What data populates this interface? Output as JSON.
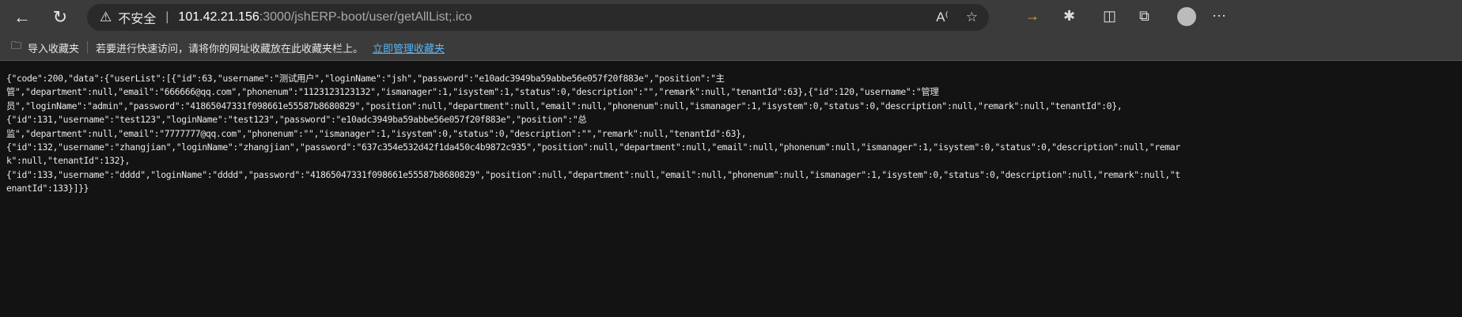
{
  "browser": {
    "security_label": "不安全",
    "url_host": "101.42.21.156",
    "url_path": ":3000/jshERP-boot/user/getAllList;.ico"
  },
  "bookmarks": {
    "import_label": "导入收藏夹",
    "hint": "若要进行快速访问，请将你的网址收藏放在此收藏夹栏上。",
    "manage_link": "立即管理收藏夹"
  },
  "response_lines": [
    "{\"code\":200,\"data\":{\"userList\":[{\"id\":63,\"username\":\"测试用户\",\"loginName\":\"jsh\",\"password\":\"e10adc3949ba59abbe56e057f20f883e\",\"position\":\"主",
    "管\",\"department\":null,\"email\":\"666666@qq.com\",\"phonenum\":\"1123123123132\",\"ismanager\":1,\"isystem\":1,\"status\":0,\"description\":\"\",\"remark\":null,\"tenantId\":63},{\"id\":120,\"username\":\"管理",
    "员\",\"loginName\":\"admin\",\"password\":\"41865047331f098661e55587b8680829\",\"position\":null,\"department\":null,\"email\":null,\"phonenum\":null,\"ismanager\":1,\"isystem\":0,\"status\":0,\"description\":null,\"remark\":null,\"tenantId\":0},",
    "{\"id\":131,\"username\":\"test123\",\"loginName\":\"test123\",\"password\":\"e10adc3949ba59abbe56e057f20f883e\",\"position\":\"总",
    "监\",\"department\":null,\"email\":\"7777777@qq.com\",\"phonenum\":\"\",\"ismanager\":1,\"isystem\":0,\"status\":0,\"description\":\"\",\"remark\":null,\"tenantId\":63},",
    "{\"id\":132,\"username\":\"zhangjian\",\"loginName\":\"zhangjian\",\"password\":\"637c354e532d42f1da450c4b9872c935\",\"position\":null,\"department\":null,\"email\":null,\"phonenum\":null,\"ismanager\":1,\"isystem\":0,\"status\":0,\"description\":null,\"remar",
    "k\":null,\"tenantId\":132},",
    "{\"id\":133,\"username\":\"dddd\",\"loginName\":\"dddd\",\"password\":\"41865047331f098661e55587b8680829\",\"position\":null,\"department\":null,\"email\":null,\"phonenum\":null,\"ismanager\":1,\"isystem\":0,\"status\":0,\"description\":null,\"remark\":null,\"t",
    "enantId\":133}]}}"
  ]
}
